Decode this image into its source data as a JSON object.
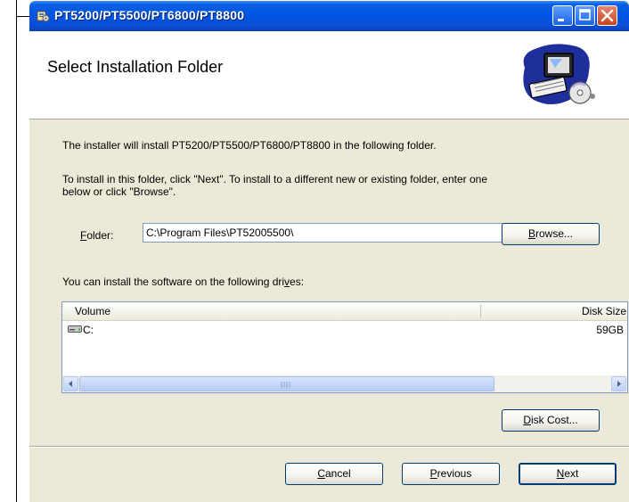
{
  "window": {
    "title": "PT5200/PT5500/PT6800/PT8800",
    "controls": [
      "minimize-icon",
      "maximize-icon",
      "close-icon"
    ]
  },
  "banner": {
    "heading": "Select Installation Folder",
    "art_icon": "computer-cd-icon"
  },
  "body": {
    "intro": "The installer will install PT5200/PT5500/PT6800/PT8800 in the following folder.",
    "instruction_line1": "To install in this folder, click \"Next\". To install to a different new or existing folder, enter one",
    "instruction_line2": "below or click \"Browse\".",
    "folder_label_access": "F",
    "folder_label_rest": "older:",
    "folder_value": "C:\\Program Files\\PT52005500\\",
    "browse_access": "B",
    "browse_rest": "rowse...",
    "drives_text_pre": "You can install the software on the following dri",
    "drives_text_access": "v",
    "drives_text_post": "es:"
  },
  "drives": {
    "columns": [
      "Volume",
      "Disk Size"
    ],
    "rows": [
      {
        "volume": "C:",
        "size": "59GB",
        "icon": "hard-drive-icon"
      }
    ]
  },
  "buttons": {
    "disk_cost_access": "D",
    "disk_cost_rest": "isk Cost...",
    "cancel_access": "C",
    "cancel_rest": "ancel",
    "previous_access": "P",
    "previous_rest": "revious",
    "next_access": "N",
    "next_rest": "ext"
  },
  "colors": {
    "titlebar": "#0055e5",
    "dialog_bg": "#ece9d8",
    "close_button": "#c9451c"
  }
}
